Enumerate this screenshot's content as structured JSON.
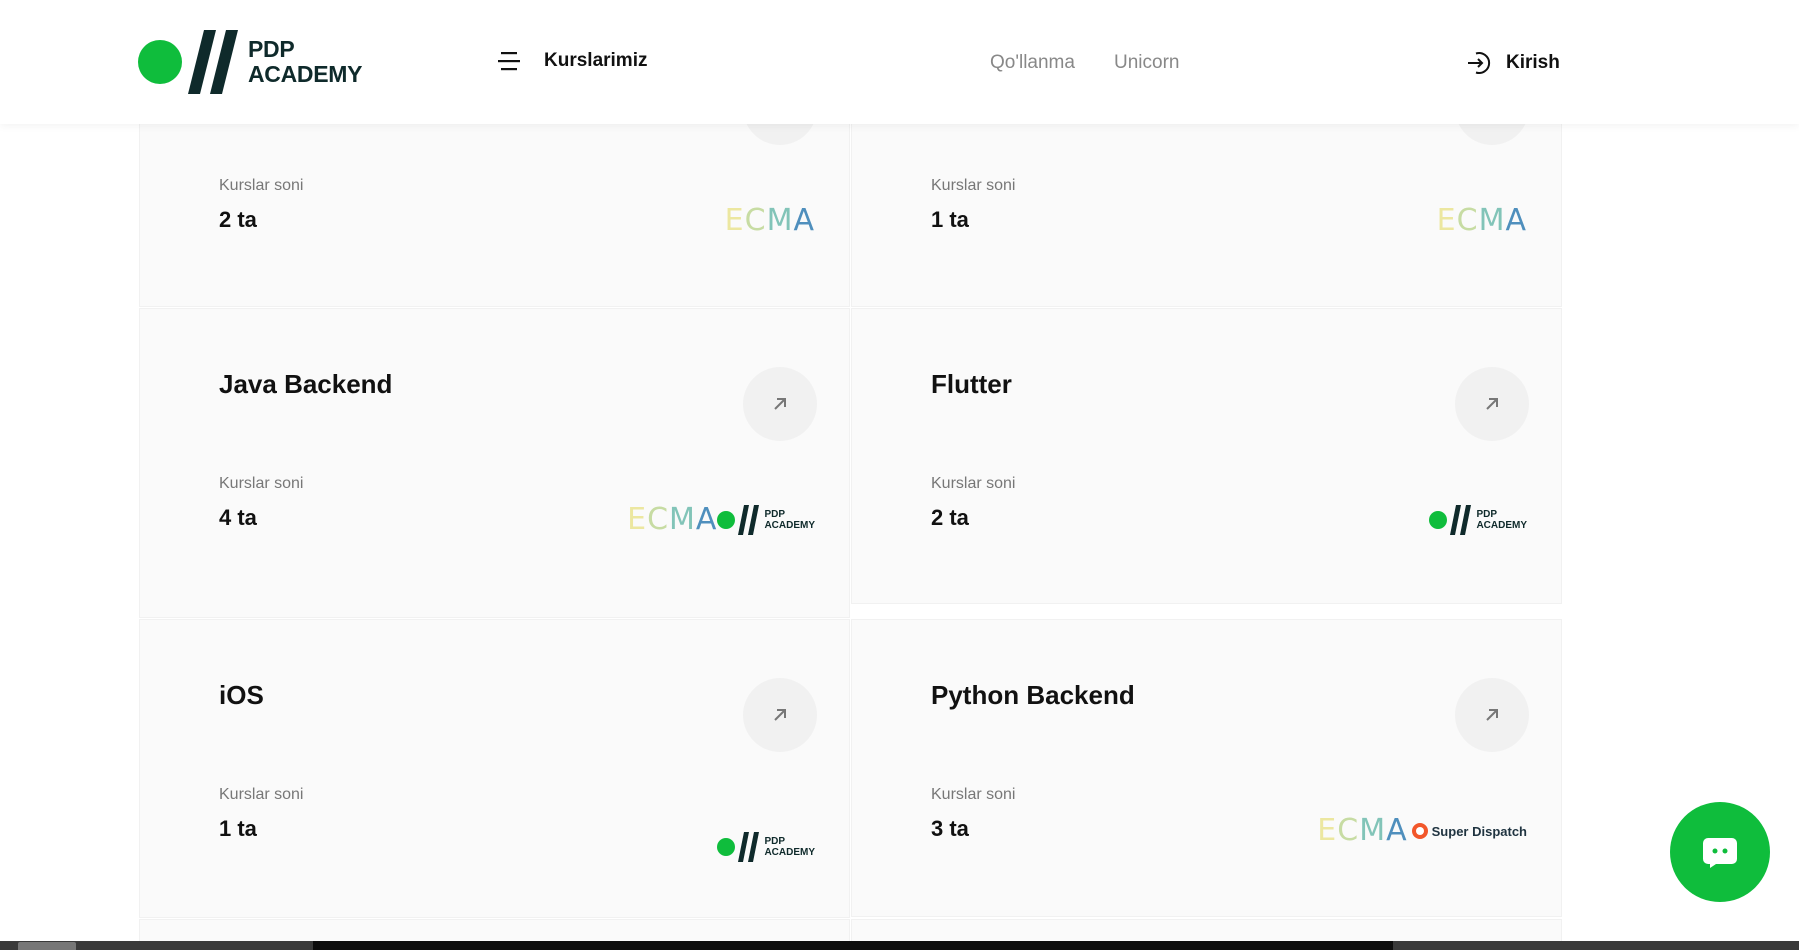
{
  "header": {
    "logo_text_line1": "PDP",
    "logo_text_line2": "ACADEMY",
    "menu_label": "Kurslarimiz",
    "nav_links": [
      "Qo'llanma",
      "Unicorn"
    ],
    "login_label": "Kirish"
  },
  "cards": [
    {
      "title": "",
      "count_label": "Kurslar soni",
      "count": "2 ta",
      "partners": [
        "ECMA"
      ]
    },
    {
      "title": "",
      "count_label": "Kurslar soni",
      "count": "1 ta",
      "partners": [
        "ECMA"
      ]
    },
    {
      "title": "Java Backend",
      "count_label": "Kurslar soni",
      "count": "4 ta",
      "partners": [
        "ECMA",
        "PDP ACADEMY"
      ]
    },
    {
      "title": "Flutter",
      "count_label": "Kurslar soni",
      "count": "2 ta",
      "partners": [
        "PDP ACADEMY"
      ]
    },
    {
      "title": "iOS",
      "count_label": "Kurslar soni",
      "count": "1 ta",
      "partners": [
        "PDP ACADEMY"
      ]
    },
    {
      "title": "Python Backend",
      "count_label": "Kurslar soni",
      "count": "3 ta",
      "partners": [
        "ECMA",
        "Super Dispatch"
      ]
    }
  ],
  "partner_logos": {
    "ecma_letters": [
      "E",
      "C",
      "M",
      "A"
    ],
    "pdp_line1": "PDP",
    "pdp_line2": "ACADEMY",
    "super_dispatch": "Super Dispatch"
  },
  "colors": {
    "brand_green": "#0fbd3c",
    "brand_dark": "#0f2a2b",
    "ecma_e": "#ece7a0",
    "ecma_c": "#c7dca3",
    "ecma_m": "#82c4b8",
    "ecma_a": "#4f8fbd",
    "super_dispatch_orange": "#f2572b"
  },
  "icons": {
    "menu": "hamburger-icon",
    "login": "login-arrow-icon",
    "card_arrow": "arrow-up-right-icon",
    "chat": "chat-bubble-icon"
  }
}
